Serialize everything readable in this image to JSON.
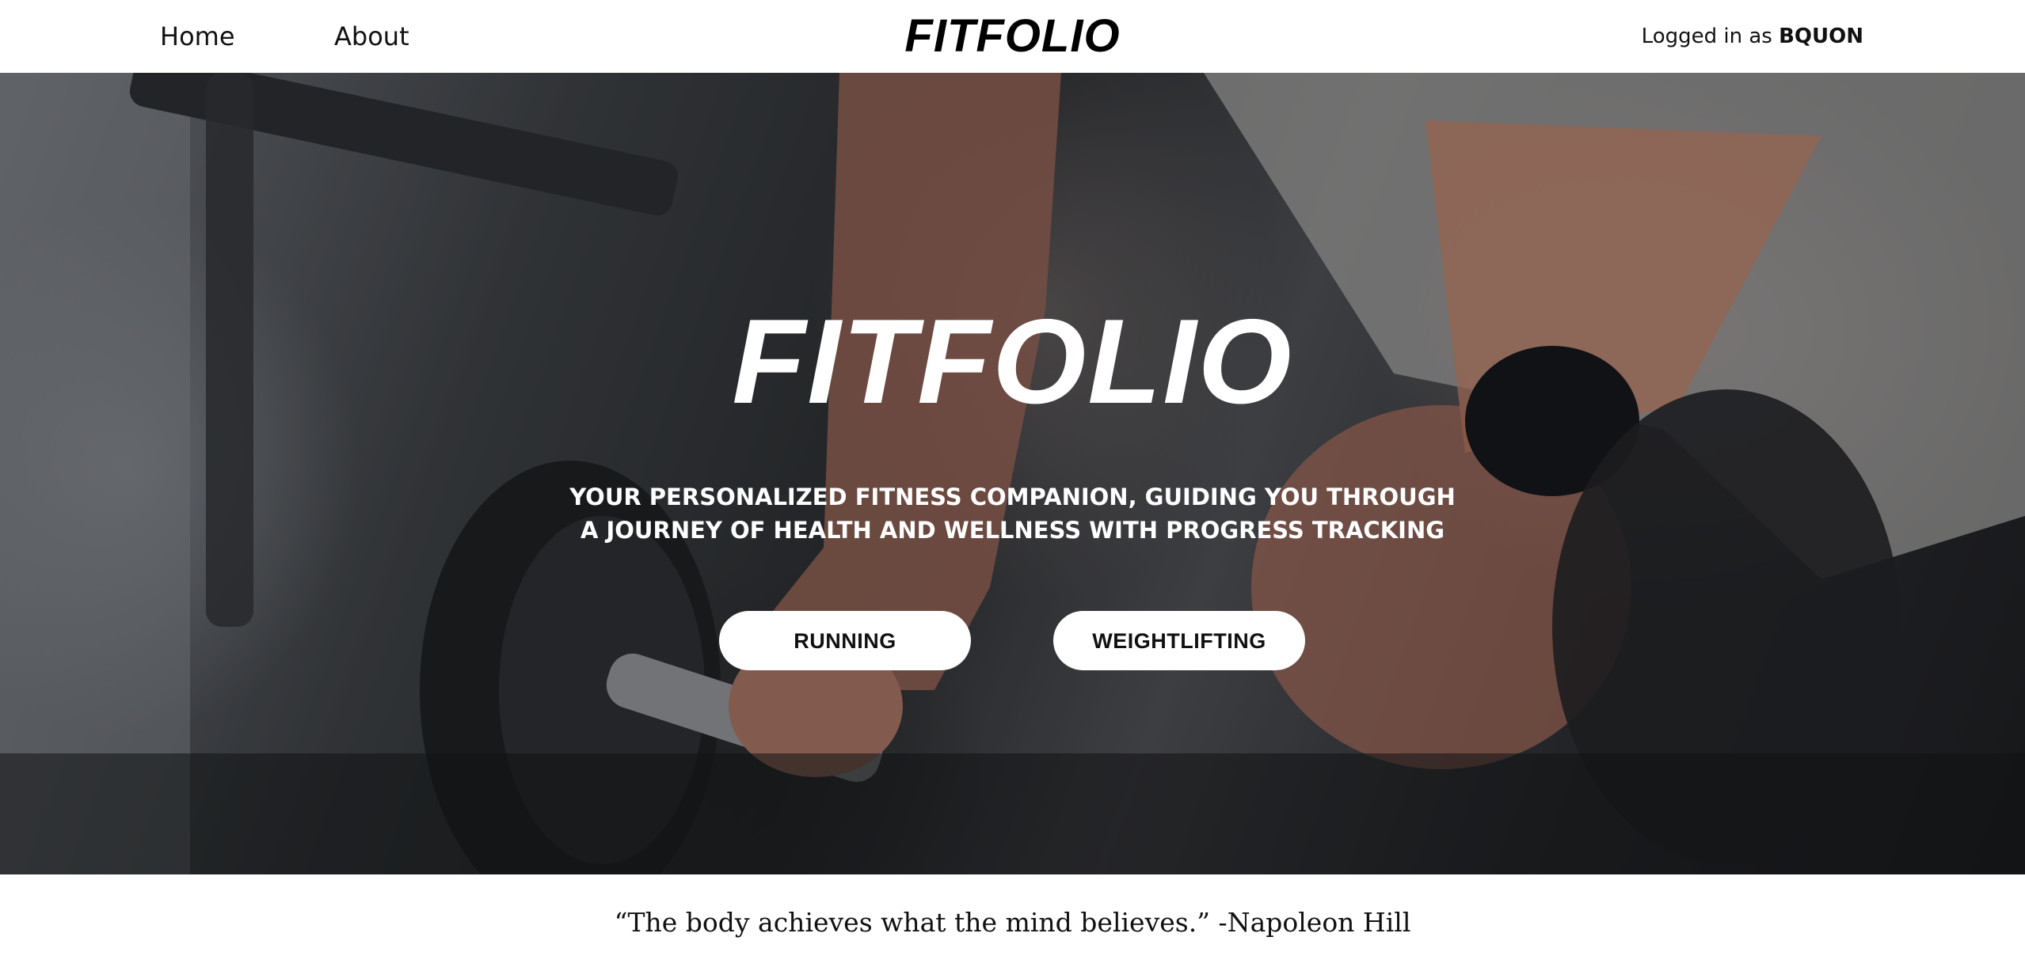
{
  "nav": {
    "links": [
      {
        "label": "Home"
      },
      {
        "label": "About"
      }
    ],
    "brand": "FITFOLIO",
    "user": {
      "prefix": "Logged in as",
      "name": "BQUON"
    }
  },
  "hero": {
    "title": "FITFOLIO",
    "subtitle_lines": [
      "YOUR PERSONALIZED FITNESS COMPANION, GUIDING YOU THROUGH",
      "A JOURNEY OF HEALTH AND WELLNESS WITH PROGRESS TRACKING"
    ],
    "buttons": [
      {
        "label": "RUNNING"
      },
      {
        "label": "WEIGHTLIFTING"
      }
    ]
  },
  "quote": {
    "text": "“The body achieves what the mind believes.” -Napoleon Hill"
  },
  "colors": {
    "nav_background": "#ffffff",
    "text_dark": "#111111",
    "hero_text": "#ffffff",
    "button_background": "#ffffff"
  }
}
